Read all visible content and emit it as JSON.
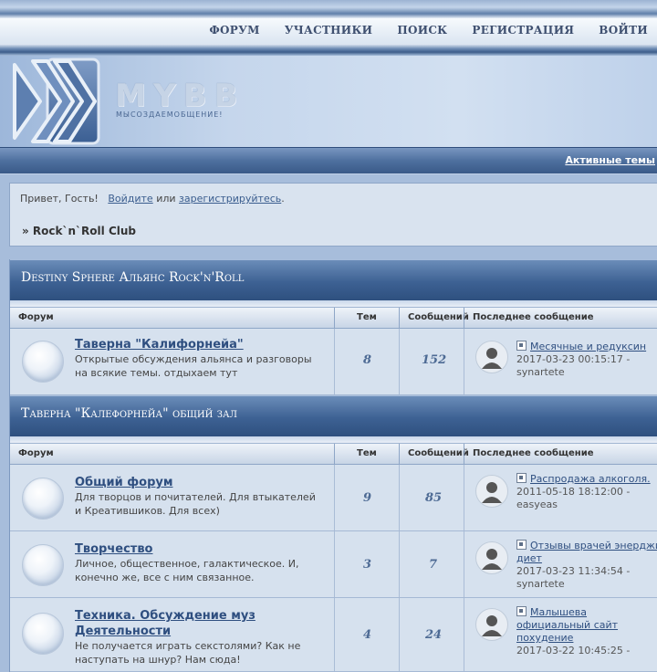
{
  "nav": {
    "items": [
      "ФОРУМ",
      "УЧАСТНИКИ",
      "ПОИСК",
      "РЕГИСТРАЦИЯ",
      "ВОЙТИ"
    ]
  },
  "header": {
    "brand": "MYBB",
    "slogan": "МЫСОЗДАЕМОБЩЕНИЕ!"
  },
  "bar": {
    "active_topics": "Активные темы"
  },
  "welcome": {
    "greeting": "Привет, Гость!",
    "login_link": "Войдите",
    "or": "или",
    "register_link": "зарегистрируйтесь",
    "dot": ".",
    "breadcrumb": "» Rock`n`Roll Club"
  },
  "columns": {
    "forum": "Форум",
    "topics": "Тем",
    "posts": "Сообщений",
    "last_post": "Последнее сообщение"
  },
  "categories": [
    {
      "title": "Destiny Sphere Альянс Rock'n'Roll",
      "forums": [
        {
          "title": "Таверна \"Калифорнейа\"",
          "desc": "Открытые обсуждения альянса и разговоры на всякие темы. отдыхаем тут",
          "topics": "8",
          "posts": "152",
          "last_title": "Месячные и редуксин",
          "last_date": "2017-03-23 00:15:17 -",
          "last_user": "synartete"
        }
      ]
    },
    {
      "title": "Таверна \"Калефорнейа\" общий зал",
      "forums": [
        {
          "title": "Общий форум",
          "desc": "Для творцов и почитателей. Для втыкателей и Креатившиков. Для всех)",
          "topics": "9",
          "posts": "85",
          "last_title": "Распродажа алкоголя.",
          "last_date": "2011-05-18 18:12:00 -",
          "last_user": "easyeas"
        },
        {
          "title": "Творчество",
          "desc": "Личное, общественное, галактическое. И, конечно же, все с ним связанное.",
          "topics": "3",
          "posts": "7",
          "last_title": "Отзывы врачей энерджи диет",
          "last_date": "2017-03-23 11:34:54 -",
          "last_user": "synartete"
        },
        {
          "title": "Техника. Обсуждение муз Деятельности",
          "desc": "Не получается играть секстолями? Как не наступать на шнур? Нам сюда!",
          "topics": "4",
          "posts": "24",
          "last_title": "Малышева официальный сайт похудение",
          "last_date": "2017-03-22 10:45:25 -",
          "last_user": ""
        }
      ]
    }
  ]
}
